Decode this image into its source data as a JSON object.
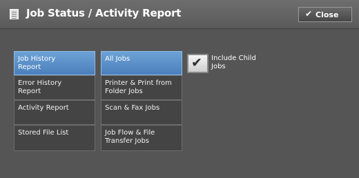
{
  "window": {
    "title": "Job Status / Activity Report",
    "close_label": "Close",
    "close_icon": "check-icon",
    "title_icon": "report-icon"
  },
  "report_types": [
    {
      "line1": "Job History",
      "line2": "Report",
      "selected": true
    },
    {
      "line1": "Error History",
      "line2": "Report",
      "selected": false
    },
    {
      "line1": "Activity Report",
      "line2": "",
      "selected": false
    },
    {
      "line1": "Stored File List",
      "line2": "",
      "selected": false
    }
  ],
  "job_filters": [
    {
      "line1": "All Jobs",
      "line2": "",
      "selected": true
    },
    {
      "line1": "Printer & Print from",
      "line2": "Folder Jobs",
      "selected": false
    },
    {
      "line1": "Scan & Fax Jobs",
      "line2": "",
      "selected": false
    },
    {
      "line1": "Job Flow & File",
      "line2": "Transfer Jobs",
      "selected": false
    }
  ],
  "include_child_jobs": {
    "line1": "Include Child",
    "line2": "Jobs",
    "checked": true
  },
  "colors": {
    "selected": "#5a8fc9",
    "button": "#444444",
    "background": "#555555"
  }
}
